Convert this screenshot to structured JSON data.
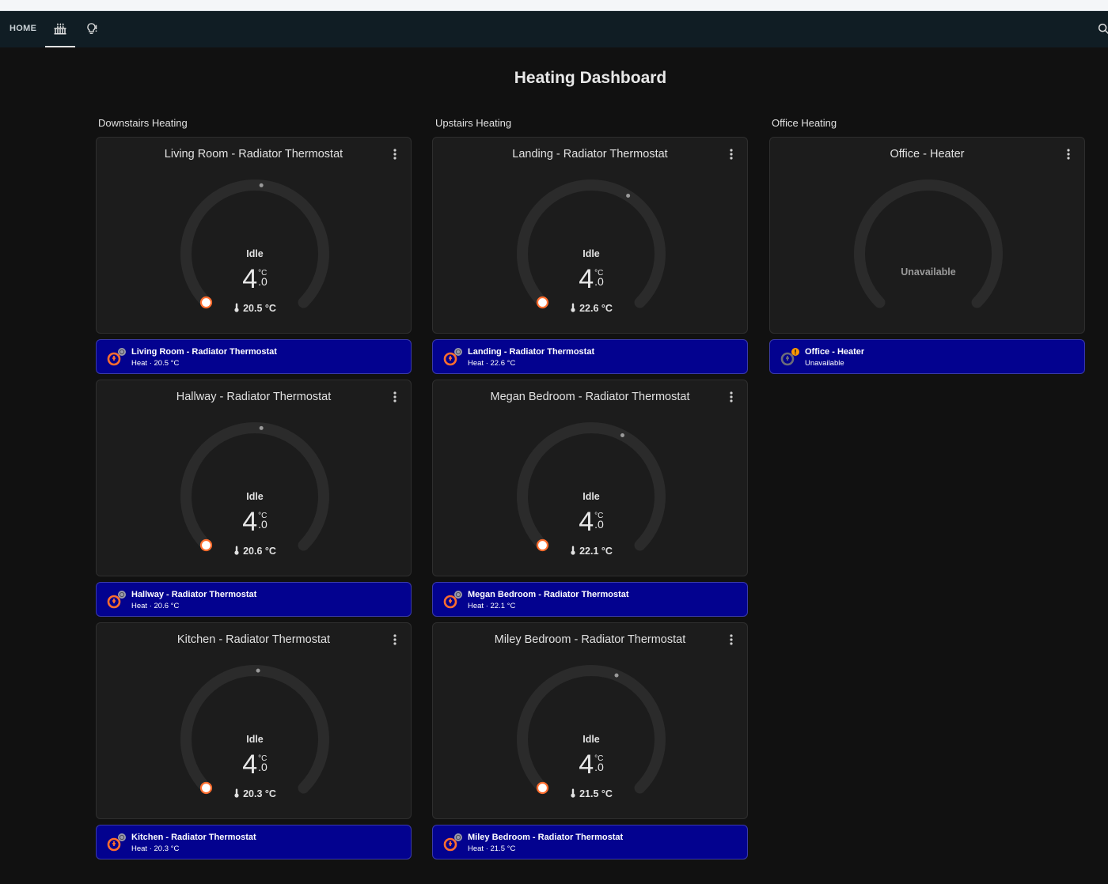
{
  "nav": {
    "home_label": "HOME",
    "tabs": [
      {
        "icon": "radiator-icon",
        "active": true
      },
      {
        "icon": "lightbulb-alert-icon",
        "active": false
      }
    ],
    "search_icon": "magnify-icon"
  },
  "page_title": "Heating Dashboard",
  "colors": {
    "background": "#111111",
    "topbar": "#101d24",
    "card": "#1c1c1c",
    "entity_bg": "#03028f",
    "accent_orange": "#ff6d2e",
    "warning": "#ff9800"
  },
  "columns": [
    {
      "title": "Downstairs Heating",
      "cards": [
        {
          "title": "Living Room - Radiator Thermostat",
          "state": "Idle",
          "target_int": "4",
          "target_unit": "°C",
          "target_dec": ".0",
          "current": "20.5 °C",
          "setpoint_fraction": 0.52,
          "entity_name": "Living Room - Radiator Thermostat",
          "entity_sub": "Heat · 20.5 °C"
        },
        {
          "title": "Hallway - Radiator Thermostat",
          "state": "Idle",
          "target_int": "4",
          "target_unit": "°C",
          "target_dec": ".0",
          "current": "20.6 °C",
          "setpoint_fraction": 0.52,
          "entity_name": "Hallway - Radiator Thermostat",
          "entity_sub": "Heat · 20.6 °C"
        },
        {
          "title": "Kitchen - Radiator Thermostat",
          "state": "Idle",
          "target_int": "4",
          "target_unit": "°C",
          "target_dec": ".0",
          "current": "20.3 °C",
          "setpoint_fraction": 0.51,
          "entity_name": "Kitchen - Radiator Thermostat",
          "entity_sub": "Heat · 20.3 °C"
        }
      ]
    },
    {
      "title": "Upstairs Heating",
      "cards": [
        {
          "title": "Landing - Radiator Thermostat",
          "state": "Idle",
          "target_int": "4",
          "target_unit": "°C",
          "target_dec": ".0",
          "current": "22.6 °C",
          "setpoint_fraction": 0.62,
          "entity_name": "Landing - Radiator Thermostat",
          "entity_sub": "Heat · 22.6 °C"
        },
        {
          "title": "Megan Bedroom - Radiator Thermostat",
          "state": "Idle",
          "target_int": "4",
          "target_unit": "°C",
          "target_dec": ".0",
          "current": "22.1 °C",
          "setpoint_fraction": 0.6,
          "entity_name": "Megan Bedroom - Radiator Thermostat",
          "entity_sub": "Heat · 22.1 °C"
        },
        {
          "title": "Miley Bedroom - Radiator Thermostat",
          "state": "Idle",
          "target_int": "4",
          "target_unit": "°C",
          "target_dec": ".0",
          "current": "21.5 °C",
          "setpoint_fraction": 0.58,
          "entity_name": "Miley Bedroom - Radiator Thermostat",
          "entity_sub": "Heat · 21.5 °C"
        }
      ]
    },
    {
      "title": "Office Heating",
      "cards": [
        {
          "title": "Office - Heater",
          "unavailable": true,
          "unavailable_label": "Unavailable",
          "entity_name": "Office - Heater",
          "entity_sub": "Unavailable"
        }
      ]
    }
  ]
}
